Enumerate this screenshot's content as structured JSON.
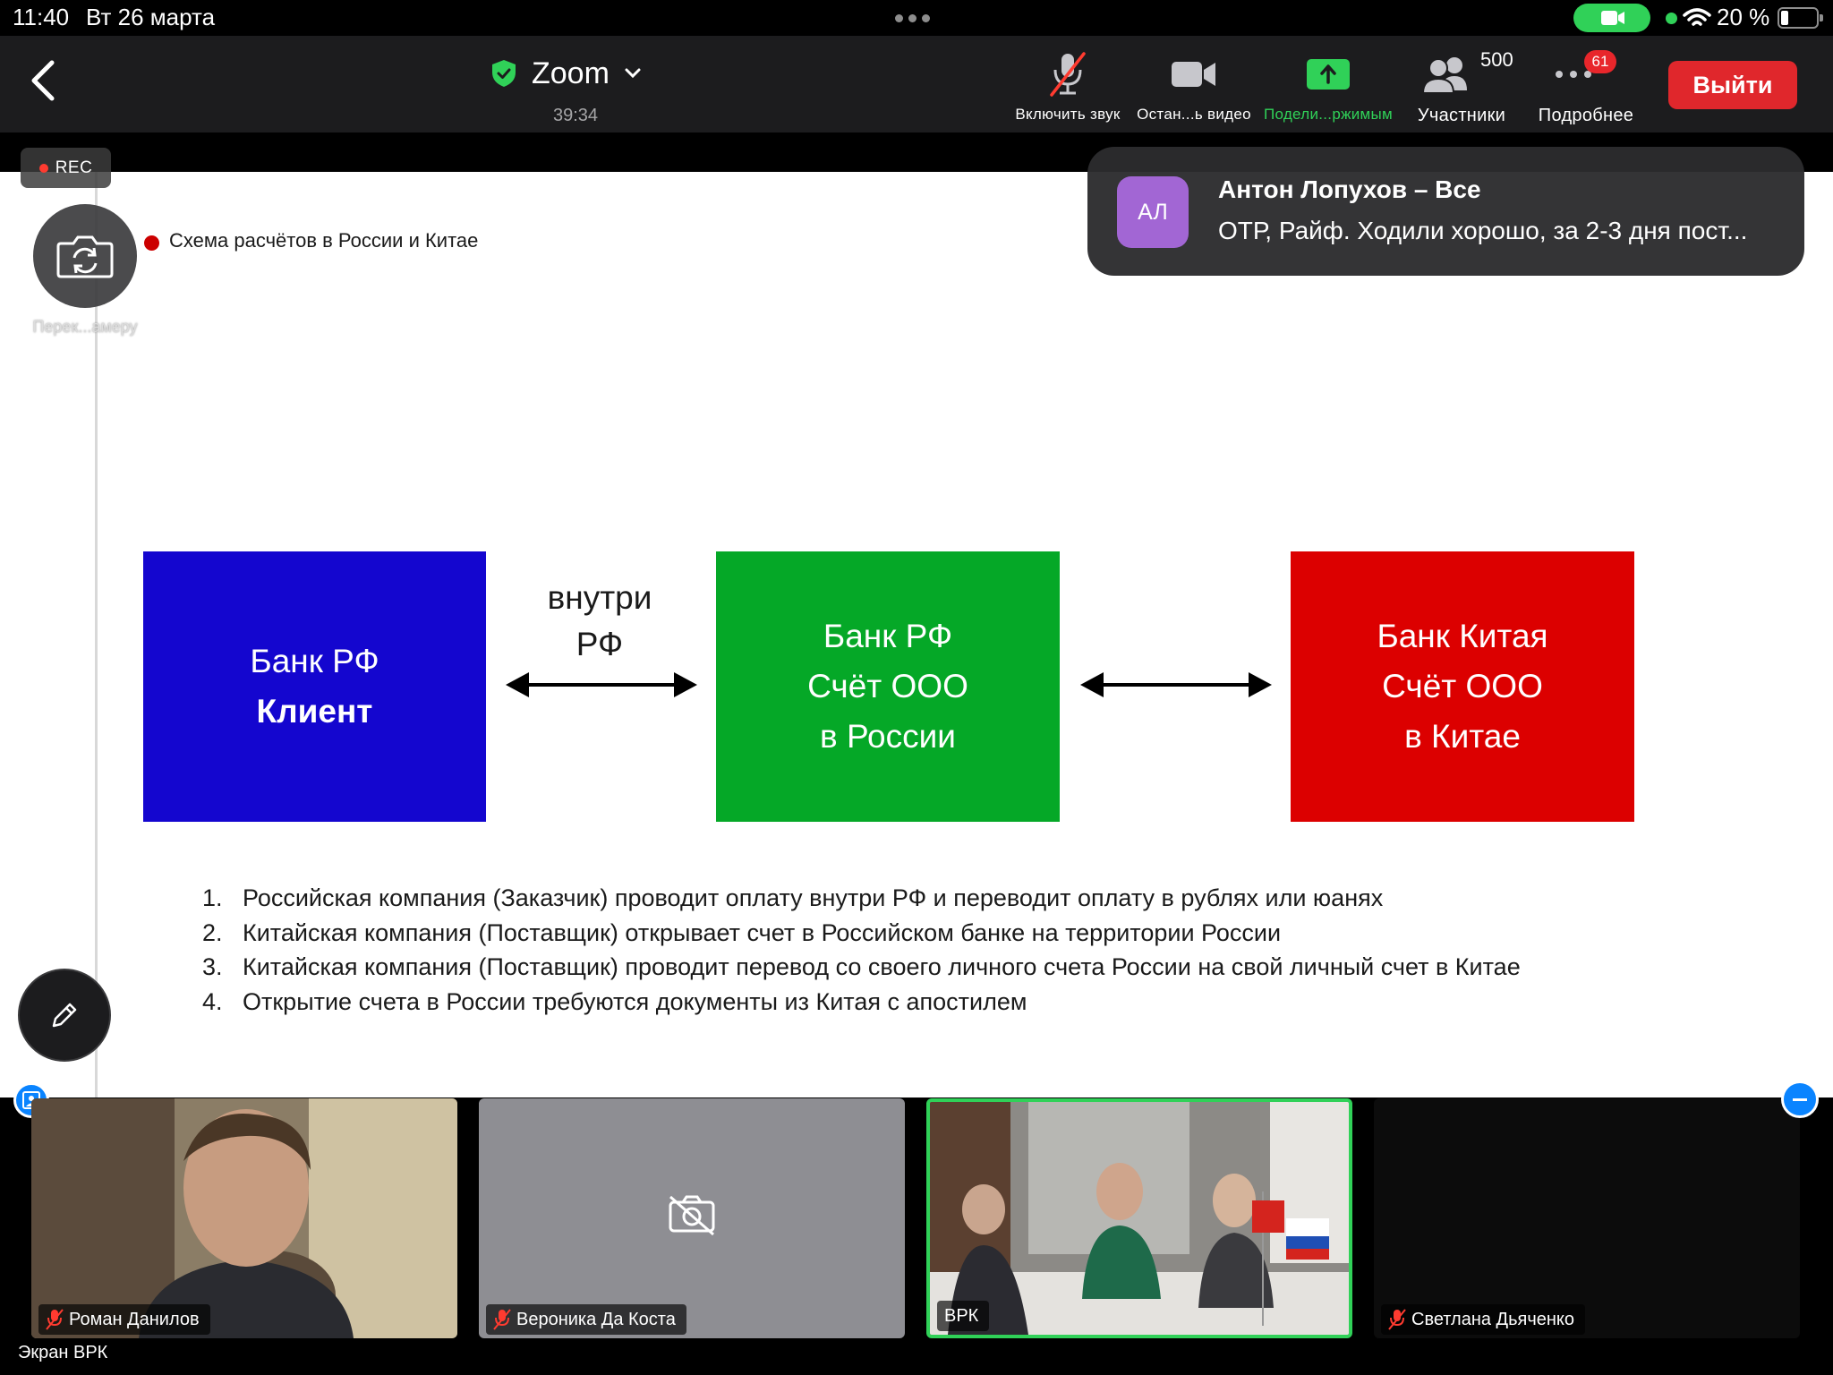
{
  "status_bar": {
    "time": "11:40",
    "date": "Вт 26 марта",
    "battery": "20 %"
  },
  "header": {
    "title": "Zoom",
    "timer": "39:34",
    "tools": {
      "unmute": "Включить звук",
      "stop_video": "Остан...ь видео",
      "share": "Подели...ржимым",
      "participants": "Участники",
      "participants_count": "500",
      "more": "Подробнее",
      "more_badge": "61"
    },
    "leave_button": "Выйти"
  },
  "overlay": {
    "rec": "REC",
    "switch_camera_label": "Перек...амеру"
  },
  "chat_toast": {
    "avatar_initials": "АЛ",
    "sender": "Антон Лопухов – Все",
    "message": "ОТР, Райф. Ходили хорошо, за 2-3 дня пост..."
  },
  "slide": {
    "heading": "Схема расчётов в России и Китае",
    "box_blue": {
      "line1": "Банк РФ",
      "line2": "Клиент",
      "color": "#1406cf"
    },
    "arrow_label": {
      "line1": "внутри",
      "line2": "РФ"
    },
    "box_green": {
      "line1": "Банк РФ",
      "line2": "Счёт ООО",
      "line3": "в России",
      "color": "#05a827"
    },
    "box_red": {
      "line1": "Банк Китая",
      "line2": "Счёт ООО",
      "line3": "в Китае",
      "color": "#dc0000"
    },
    "list": [
      {
        "num": "1.",
        "text": "Российская компания (Заказчик) проводит оплату внутри РФ и переводит  оплату в рублях или юанях"
      },
      {
        "num": "2.",
        "text": "Китайская компания (Поставщик) открывает счет в Российском банке на территории России"
      },
      {
        "num": "3.",
        "text": "Китайская компания (Поставщик) проводит  перевод со своего личного счета России на свой личный счет в Китае"
      },
      {
        "num": "4.",
        "text": "Открытие счета в России требуются документы из Китая с апостилем"
      }
    ]
  },
  "participants": [
    {
      "name": "Роман Данилов",
      "muted": true
    },
    {
      "name": "Вероника Да Коста",
      "muted": true,
      "video_off": true
    },
    {
      "name": "ВРК",
      "muted": false,
      "active_speaker": true
    },
    {
      "name": "Светлана Дьяченко",
      "muted": true
    }
  ],
  "screen_label": "Экран ВРК",
  "colors": {
    "accent_green": "#30d158",
    "leave_red": "#e0272c",
    "badge_red": "#e8262b",
    "avatar_purple": "#a266d4"
  }
}
